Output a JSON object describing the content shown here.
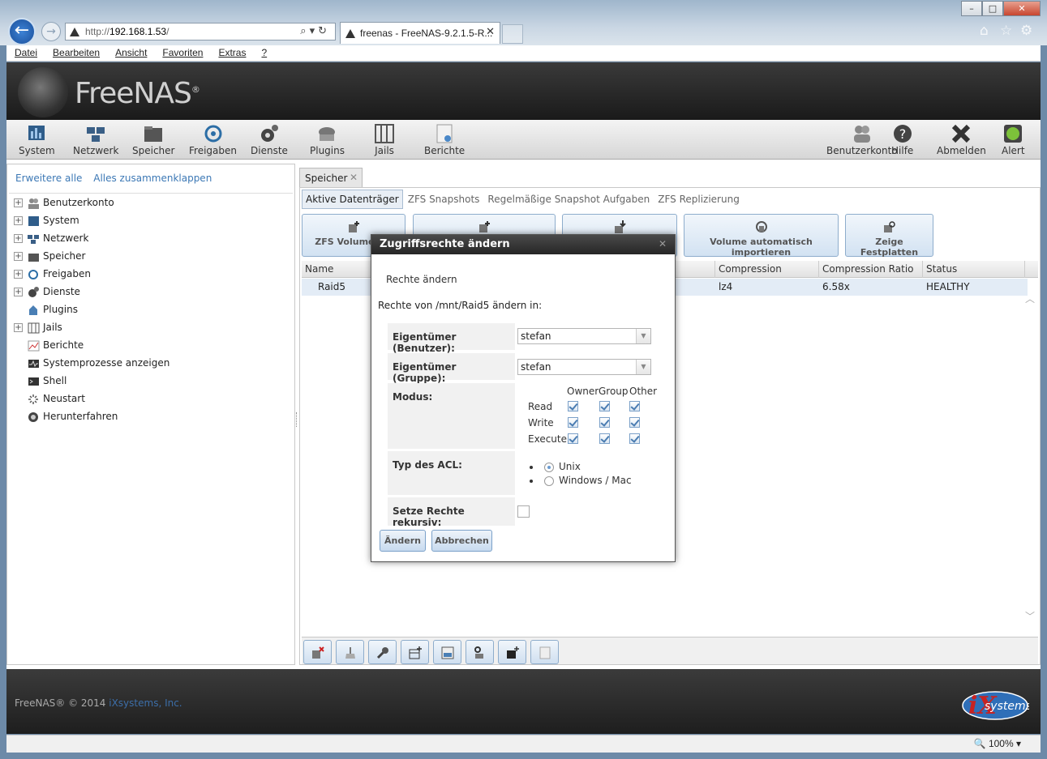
{
  "browser": {
    "url_prefix": "http://",
    "url_host": "192.168.1.53",
    "url_suffix": "/",
    "tab_title": "freenas - FreeNAS-9.2.1.5-R...",
    "menu": [
      "Datei",
      "Bearbeiten",
      "Ansicht",
      "Favoriten",
      "Extras",
      "?"
    ],
    "zoom": "100%"
  },
  "app": {
    "logo": "FreeNAS",
    "logo_mark": "®",
    "toolbar": [
      {
        "label": "System",
        "icon": "system-icon"
      },
      {
        "label": "Netzwerk",
        "icon": "network-icon"
      },
      {
        "label": "Speicher",
        "icon": "storage-icon"
      },
      {
        "label": "Freigaben",
        "icon": "sharing-icon"
      },
      {
        "label": "Dienste",
        "icon": "services-icon"
      },
      {
        "label": "Plugins",
        "icon": "plugins-icon"
      },
      {
        "label": "Jails",
        "icon": "jails-icon"
      },
      {
        "label": "Berichte",
        "icon": "reports-icon"
      },
      {
        "label": "Benutzerkonto",
        "icon": "account-icon"
      },
      {
        "label": "Hilfe",
        "icon": "help-icon"
      },
      {
        "label": "Abmelden",
        "icon": "logout-icon"
      },
      {
        "label": "Alert",
        "icon": "alert-icon"
      }
    ],
    "tree_links": {
      "expand": "Erweitere alle",
      "collapse": "Alles zusammenklappen"
    },
    "tree": [
      {
        "label": "Benutzerkonto",
        "expandable": true
      },
      {
        "label": "System",
        "expandable": true
      },
      {
        "label": "Netzwerk",
        "expandable": true
      },
      {
        "label": "Speicher",
        "expandable": true
      },
      {
        "label": "Freigaben",
        "expandable": true
      },
      {
        "label": "Dienste",
        "expandable": true
      },
      {
        "label": "Plugins",
        "expandable": false
      },
      {
        "label": "Jails",
        "expandable": true
      },
      {
        "label": "Berichte",
        "expandable": false
      },
      {
        "label": "Systemprozesse anzeigen",
        "expandable": false
      },
      {
        "label": "Shell",
        "expandable": false
      },
      {
        "label": "Neustart",
        "expandable": false
      },
      {
        "label": "Herunterfahren",
        "expandable": false
      }
    ],
    "main_tab": "Speicher",
    "sub_tabs": [
      "Aktive Datenträger",
      "ZFS Snapshots",
      "Regelmäßige Snapshot Aufgaben",
      "ZFS Replizierung"
    ],
    "actions": [
      "ZFS Volume Ma",
      "Volume automatisch importieren",
      "Zeige Festplatten"
    ],
    "grid": {
      "columns": [
        "Name",
        "Compression",
        "Compression Ratio",
        "Status"
      ],
      "rows": [
        {
          "name": "Raid5",
          "compression": "lz4",
          "ratio": "6.58x",
          "status": "HEALTHY"
        }
      ]
    },
    "footer": {
      "copyright": "FreeNAS® © 2014 ",
      "company": "iXsystems, Inc.",
      "logo_text": "systems"
    }
  },
  "dialog": {
    "title": "Zugriffsrechte ändern",
    "subtitle": "Rechte ändern",
    "path_text": "Rechte von /mnt/Raid5 ändern in:",
    "owner_user_label": "Eigentümer (Benutzer):",
    "owner_user_value": "stefan",
    "owner_group_label": "Eigentümer (Gruppe):",
    "owner_group_value": "stefan",
    "mode_label": "Modus:",
    "mode_columns": [
      "Owner",
      "Group",
      "Other"
    ],
    "mode_rows": [
      "Read",
      "Write",
      "Execute"
    ],
    "acl_label": "Typ des ACL:",
    "acl_options": [
      "Unix",
      "Windows / Mac"
    ],
    "acl_selected": "Unix",
    "recursive_label": "Setze Rechte rekursiv:",
    "recursive_checked": false,
    "ok_label": "Ändern",
    "cancel_label": "Abbrechen"
  }
}
